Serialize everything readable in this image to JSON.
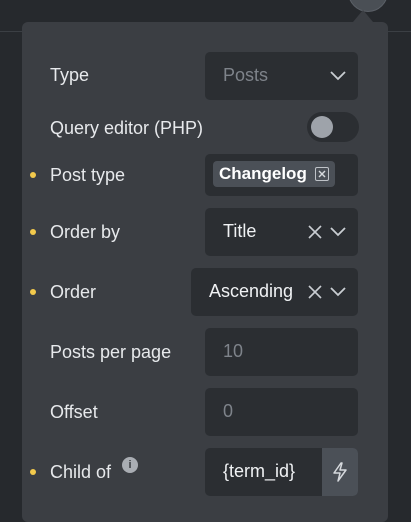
{
  "panel": {
    "type": {
      "label": "Type",
      "placeholder": "Posts"
    },
    "query_editor": {
      "label": "Query editor (PHP)",
      "enabled": false
    },
    "post_type": {
      "label": "Post type",
      "tag": "Changelog"
    },
    "order_by": {
      "label": "Order by",
      "value": "Title"
    },
    "order": {
      "label": "Order",
      "value": "Ascending"
    },
    "posts_per_page": {
      "label": "Posts per page",
      "placeholder": "10"
    },
    "offset": {
      "label": "Offset",
      "placeholder": "0"
    },
    "child_of": {
      "label": "Child of",
      "value": "{term_id}"
    }
  },
  "icons": {
    "chevron": "chevron-down-icon",
    "clear": "close-icon",
    "info": "info-icon",
    "dynamic": "lightning-icon"
  },
  "colors": {
    "background": "#26292d",
    "panel": "#3b3e43",
    "control": "#2b2e32",
    "accent_dot": "#f2c94c"
  }
}
